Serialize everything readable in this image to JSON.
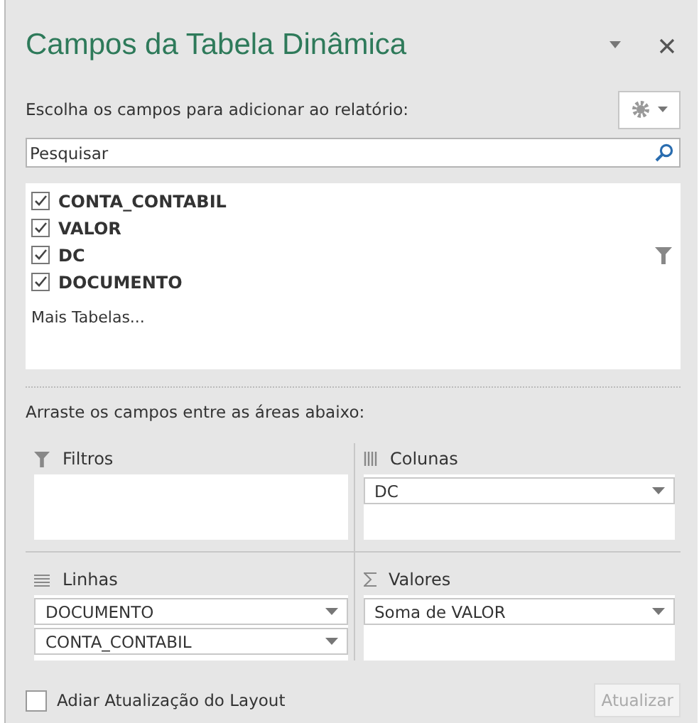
{
  "title": "Campos da Tabela Dinâmica",
  "choose_label": "Escolha os campos para adicionar ao relatório:",
  "search": {
    "placeholder": "Pesquisar"
  },
  "fields": [
    {
      "label": "CONTA_CONTABIL",
      "checked": true,
      "filtered": false
    },
    {
      "label": "VALOR",
      "checked": true,
      "filtered": false
    },
    {
      "label": "DC",
      "checked": true,
      "filtered": true
    },
    {
      "label": "DOCUMENTO",
      "checked": true,
      "filtered": false
    }
  ],
  "more_tables": "Mais Tabelas...",
  "drag_label": "Arraste os campos entre as áreas abaixo:",
  "areas": [
    {
      "kind": "filter",
      "label": "Filtros"
    },
    {
      "kind": "columns",
      "label": "Colunas",
      "items": [
        "DC"
      ]
    },
    {
      "kind": "rows",
      "label": "Linhas",
      "items": [
        "DOCUMENTO",
        "CONTA_CONTABIL"
      ]
    },
    {
      "kind": "values",
      "label": "Valores",
      "items": [
        "Soma de VALOR"
      ]
    }
  ],
  "defer": {
    "label": "Adiar Atualização do Layout",
    "checked": false
  },
  "update_button": {
    "label": "Atualizar",
    "disabled": true
  }
}
